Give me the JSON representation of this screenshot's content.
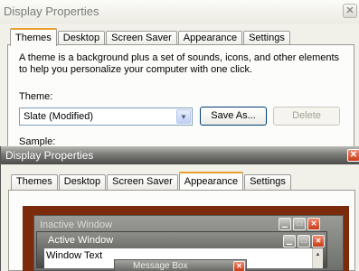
{
  "back_window": {
    "title": "Display Properties",
    "close_glyph": "✕",
    "tabs": [
      {
        "label": "Themes",
        "active": true
      },
      {
        "label": "Desktop"
      },
      {
        "label": "Screen Saver"
      },
      {
        "label": "Appearance"
      },
      {
        "label": "Settings"
      }
    ],
    "description": "A theme is a background plus a set of sounds, icons, and other elements to help you personalize your computer with one click.",
    "theme_label": "Theme:",
    "theme_value": "Slate (Modified)",
    "save_as_label": "Save As...",
    "delete_label": "Delete",
    "sample_label": "Sample:"
  },
  "front_window": {
    "title": "Display Properties",
    "close_glyph": "✕",
    "tabs": [
      {
        "label": "Themes"
      },
      {
        "label": "Desktop"
      },
      {
        "label": "Screen Saver"
      },
      {
        "label": "Appearance",
        "active": true
      },
      {
        "label": "Settings"
      }
    ],
    "preview": {
      "inactive_window_title": "Inactive Window",
      "active_window_title": "Active Window",
      "window_text": "Window Text",
      "message_box_title": "Message Box"
    }
  },
  "colors": {
    "tab_active_accent": "#e8a12f",
    "close_button": "#c73a17",
    "preview_desktop": "#7b2a0c"
  }
}
